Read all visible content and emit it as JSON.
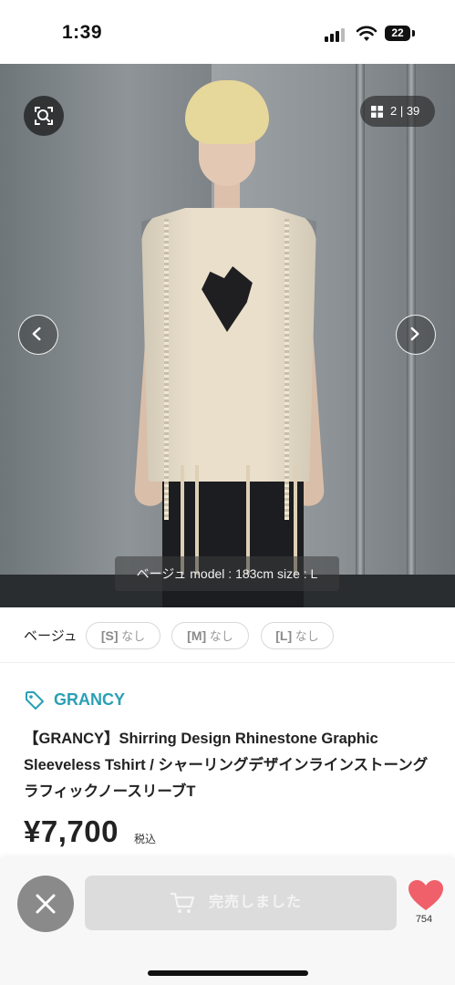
{
  "status_bar": {
    "time": "1:39",
    "battery": "22"
  },
  "gallery": {
    "counter": "2 | 39",
    "caption": "ベージュ model : 183cm size : L",
    "icons": {
      "zoom": "search-scan-icon",
      "grid": "grid-icon",
      "prev": "chevron-left-icon",
      "next": "chevron-right-icon"
    }
  },
  "variant": {
    "color_label": "ベージュ",
    "sizes": [
      {
        "size": "[S]",
        "stock": "なし"
      },
      {
        "size": "[M]",
        "stock": "なし"
      },
      {
        "size": "[L]",
        "stock": "なし"
      }
    ]
  },
  "product": {
    "brand": "GRANCY",
    "title": "【GRANCY】Shirring Design Rhinestone Graphic Sleeveless Tshirt / シャーリングデザインラインストーングラフィックノースリーブT",
    "price": "¥7,700",
    "tax_label": "税込"
  },
  "actions": {
    "sold_label": "完売しました",
    "like_count": "754"
  },
  "colors": {
    "brand": "#2a9fb5",
    "heart": "#f0606a",
    "sold_button": "#dcdcdc",
    "close_button": "#8a8a8a"
  }
}
